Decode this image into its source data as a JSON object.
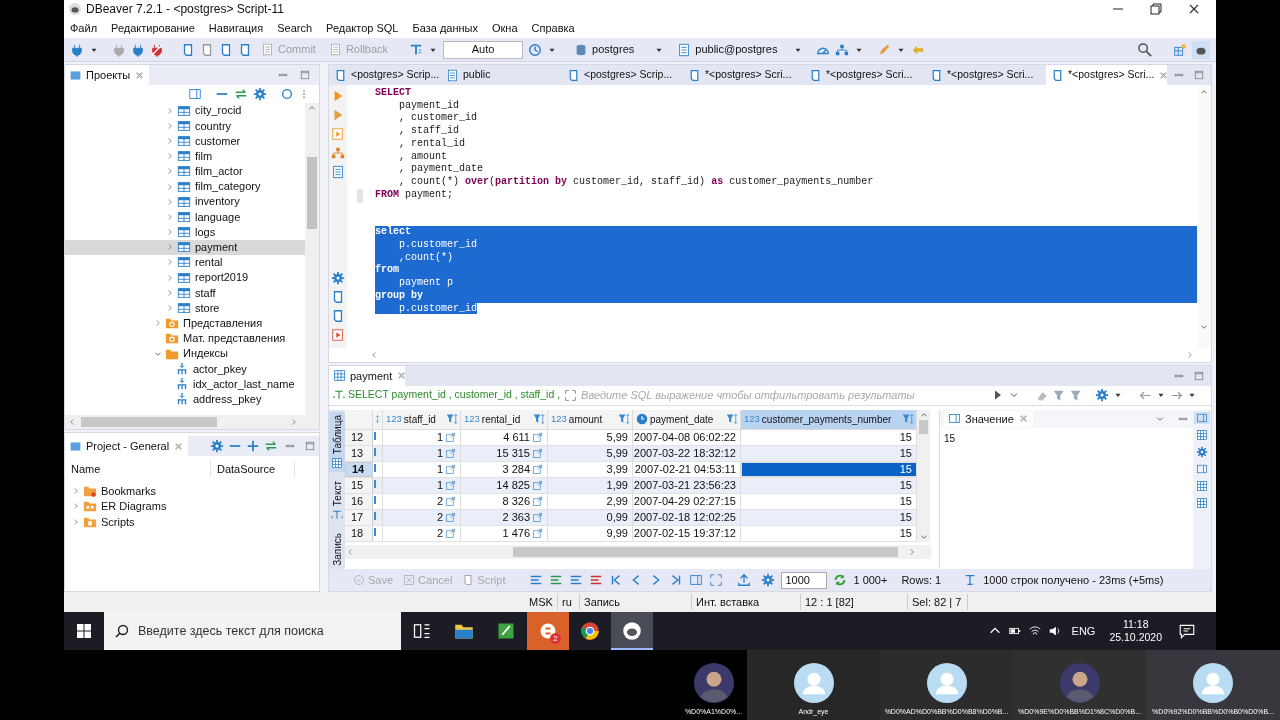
{
  "window": {
    "title": "DBeaver 7.2.1 - <postgres> Script-11"
  },
  "menu": [
    "Файл",
    "Редактирование",
    "Навигация",
    "Search",
    "Редактор SQL",
    "База данных",
    "Окна",
    "Справка"
  ],
  "toolbar": {
    "commit": {
      "label": "Commit",
      "disabled": true
    },
    "rollback": {
      "label": "Rollback",
      "disabled": true
    },
    "transaction_mode": "Auto",
    "datasource": "postgres",
    "schema": "public@postgres"
  },
  "projects": {
    "title": "Проекты",
    "tables": [
      {
        "label": "city_rocid",
        "selected": false
      },
      {
        "label": "country",
        "selected": false
      },
      {
        "label": "customer",
        "selected": false
      },
      {
        "label": "film",
        "selected": false
      },
      {
        "label": "film_actor",
        "selected": false
      },
      {
        "label": "film_category",
        "selected": false
      },
      {
        "label": "inventory",
        "selected": false
      },
      {
        "label": "language",
        "selected": false
      },
      {
        "label": "logs",
        "selected": false
      },
      {
        "label": "payment",
        "selected": true
      },
      {
        "label": "rental",
        "selected": false
      },
      {
        "label": "report2019",
        "selected": false
      },
      {
        "label": "staff",
        "selected": false
      },
      {
        "label": "store",
        "selected": false
      }
    ],
    "folders": [
      {
        "label": "Представления",
        "kind": "views",
        "expanded": false
      },
      {
        "label": "Мат. представления",
        "kind": "views_leaf"
      },
      {
        "label": "Индексы",
        "kind": "folder",
        "expanded": true,
        "children": [
          {
            "label": "actor_pkey"
          },
          {
            "label": "idx_actor_last_name"
          },
          {
            "label": "address_pkey"
          }
        ]
      }
    ]
  },
  "project_general": {
    "title": "Project - General",
    "columns": [
      "Name",
      "DataSource"
    ],
    "items": [
      {
        "label": "Bookmarks",
        "kind": "bookmarks"
      },
      {
        "label": "ER Diagrams",
        "kind": "diagrams"
      },
      {
        "label": "Scripts",
        "kind": "scripts"
      }
    ]
  },
  "editor_tabs": [
    {
      "label": "<postgres> Scrip...",
      "kind": "script",
      "selected": false
    },
    {
      "label": "public",
      "kind": "schema",
      "selected": false
    },
    {
      "label": "<postgres> Scrip...",
      "kind": "script",
      "selected": false
    },
    {
      "label": "*<postgres> Scri...",
      "kind": "script",
      "selected": false
    },
    {
      "label": "*<postgres> Scri...",
      "kind": "script",
      "selected": false
    },
    {
      "label": "*<postgres> Scri...",
      "kind": "script",
      "selected": false
    },
    {
      "label": "*<postgres> Scri...",
      "kind": "script",
      "selected": true
    }
  ],
  "code": [
    {
      "selected": false,
      "lines": [
        {
          "text": "SELECT",
          "kind": "keyword"
        },
        {
          "text": "    payment_id",
          "kind": "code"
        },
        {
          "text": "    , customer_id",
          "kind": "code"
        },
        {
          "text": "    , staff_id",
          "kind": "code"
        },
        {
          "text": "    , rental_id",
          "kind": "code"
        },
        {
          "text": "    , amount",
          "kind": "code"
        },
        {
          "text": "    , payment_date",
          "kind": "code"
        },
        {
          "text": "    , count(*) **over**(**partition** **by** customer_id, staff_id) **as** customer_payments_number",
          "kind": "code"
        },
        {
          "text": "**FROM** payment;",
          "kind": "code"
        }
      ]
    },
    {
      "selected": true,
      "lines": [
        {
          "text": "select",
          "kind": "keyword"
        },
        {
          "text": "    p.customer_id",
          "kind": "code"
        },
        {
          "text": "    ,count(*)",
          "kind": "code"
        },
        {
          "text": "from",
          "kind": "keyword"
        },
        {
          "text": "    payment p",
          "kind": "code"
        },
        {
          "text": "group by",
          "kind": "keyword"
        },
        {
          "text": "    p.customer_id",
          "kind": "code"
        }
      ]
    }
  ],
  "results": {
    "tab": "payment",
    "query": "SELECT payment_id , customer_id , staff_id ,",
    "filter_placeholder": "Введите SQL выражение чтобы отфильтровать результаты",
    "view_tabs": [
      {
        "label": "Таблица",
        "selected": true
      },
      {
        "label": "Текст",
        "selected": false
      },
      {
        "label": "Запись",
        "selected": false
      }
    ],
    "columns": [
      {
        "label": "staff_id",
        "kind": "number",
        "type_label": "123",
        "link": true,
        "selected": false
      },
      {
        "label": "rental_id",
        "kind": "number",
        "type_label": "123",
        "link": true,
        "selected": false
      },
      {
        "label": "amount",
        "kind": "number",
        "type_label": "123",
        "link": false,
        "selected": false
      },
      {
        "label": "payment_date",
        "kind": "date",
        "link": false,
        "selected": false
      },
      {
        "label": "customer_payments_number",
        "kind": "number",
        "type_label": "123",
        "link": false,
        "selected": true
      }
    ],
    "rows": [
      {
        "number": "12",
        "selected": false,
        "cells": [
          "1",
          "4 611",
          "5,99",
          "2007-04-08 06:02:22",
          "15"
        ]
      },
      {
        "number": "13",
        "selected": false,
        "cells": [
          "1",
          "15 315",
          "5,99",
          "2007-03-22 18:32:12",
          "15"
        ]
      },
      {
        "number": "14",
        "selected": true,
        "cells": [
          "1",
          "3 284",
          "3,99",
          "2007-02-21 04:53:11",
          "15"
        ]
      },
      {
        "number": "15",
        "selected": false,
        "cells": [
          "1",
          "14 825",
          "1,99",
          "2007-03-21 23:56:23",
          "15"
        ]
      },
      {
        "number": "16",
        "selected": false,
        "cells": [
          "2",
          "8 326",
          "2,99",
          "2007-04-29 02:27:15",
          "15"
        ]
      },
      {
        "number": "17",
        "selected": false,
        "cells": [
          "2",
          "2 363",
          "0,99",
          "2007-02-18 12:02:25",
          "15"
        ]
      },
      {
        "number": "18",
        "selected": false,
        "cells": [
          "2",
          "1 476",
          "9,99",
          "2007-02-15 19:37:12",
          "15"
        ]
      }
    ]
  },
  "value_panel": {
    "title": "Значение",
    "value": "15"
  },
  "results_toolbar": {
    "save": {
      "label": "Save",
      "disabled": true
    },
    "cancel": {
      "label": "Cancel",
      "disabled": true
    },
    "script": {
      "label": "Script",
      "disabled": true
    },
    "fetch_size": "1000",
    "fetch_count": "1 000+",
    "rows": "Rows: 1",
    "info": "1000 строк получено - 23ms (+5ms)"
  },
  "status_bar": [
    "MSK",
    "ru",
    "Запись",
    "Инт. вставка",
    "12 : 1 [82]",
    "Sel: 82 | 7"
  ],
  "taskbar": {
    "search_placeholder": "Введите здесь текст для поиска",
    "apps": [
      {
        "kind": "taskview",
        "active": false
      },
      {
        "kind": "files",
        "active": false
      },
      {
        "kind": "editor",
        "active": false
      },
      {
        "kind": "chat",
        "active": false,
        "badge": "2"
      },
      {
        "kind": "browser",
        "active": false
      },
      {
        "kind": "dbeaver",
        "active": true
      }
    ],
    "language": "ENG",
    "time": "11:18",
    "date": "25.10.2020"
  },
  "participants": [
    {
      "name": "%D0%A1%D0%...",
      "kind": "photo"
    },
    {
      "name": "Andr_eye",
      "kind": "generic"
    },
    {
      "name": "%D0%AD%D0%BB%D0%B8%D0%B...",
      "kind": "generic"
    },
    {
      "name": "%D0%9E%D0%BB%D1%8C%D0%B...",
      "kind": "photo"
    },
    {
      "name": "%D0%92%D0%BB%D0%B0%D0%B...",
      "kind": "generic"
    }
  ]
}
